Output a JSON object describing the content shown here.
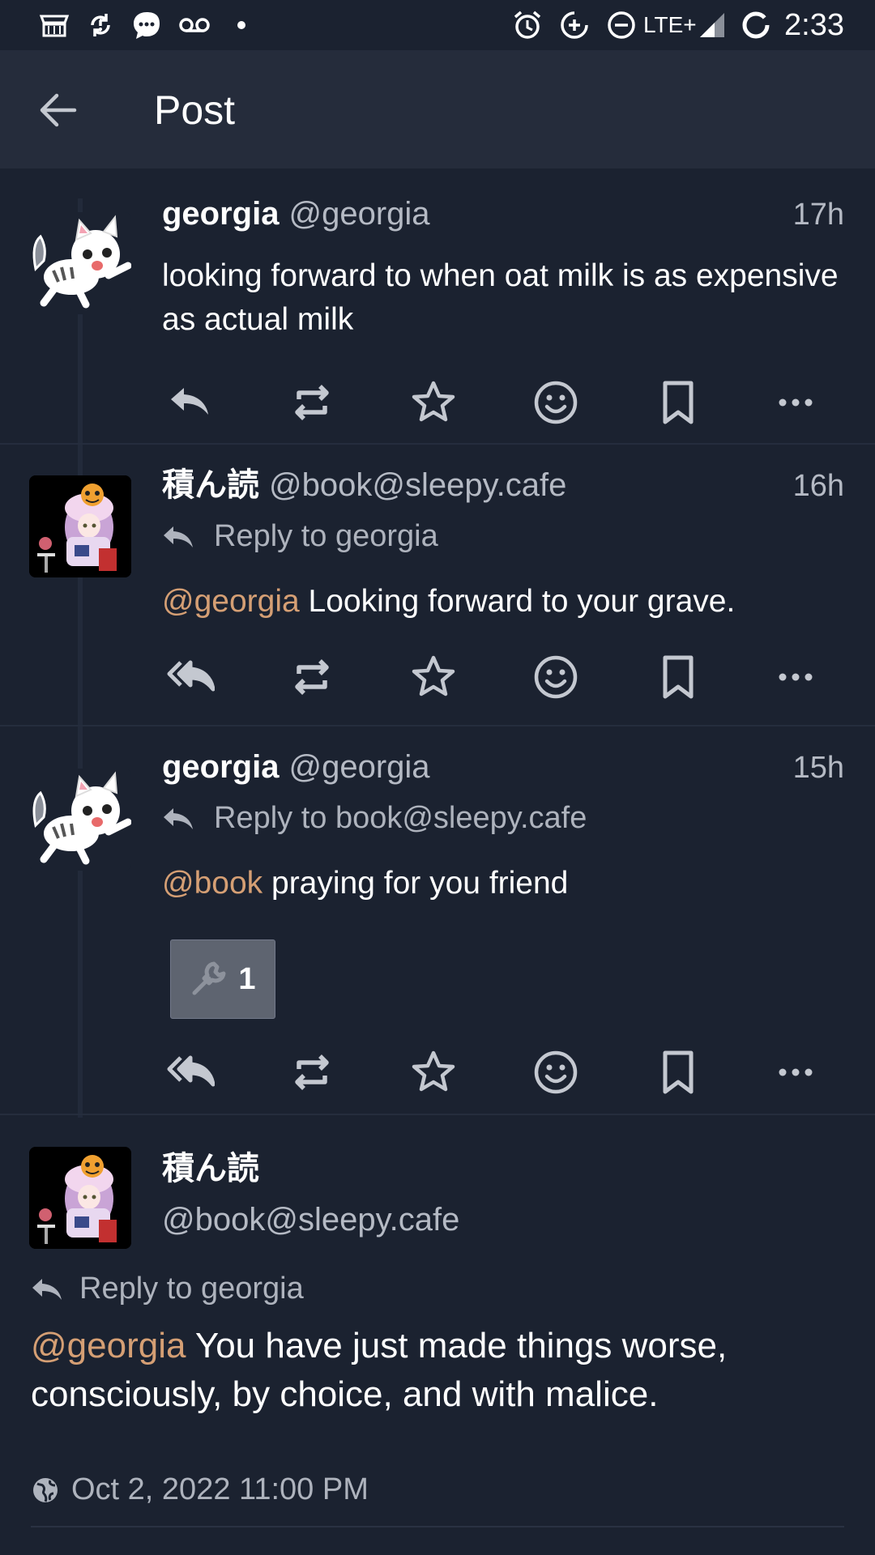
{
  "status_bar": {
    "time": "2:33",
    "network": "LTE+",
    "icons": [
      "store-icon",
      "sync-icon",
      "message-icon",
      "voicemail-icon",
      "dot-icon",
      "alarm-icon",
      "data-saver-icon",
      "do-not-disturb-icon",
      "signal-icon",
      "battery-icon"
    ]
  },
  "app_bar": {
    "title": "Post",
    "back_icon": "arrow-left-icon"
  },
  "posts": [
    {
      "display_name": "georgia",
      "handle": "@georgia",
      "time": "17h",
      "reply_to": "",
      "mention": "",
      "text": "looking forward to when oat milk is as expensive as actual milk",
      "actions": [
        "reply-icon",
        "boost-icon",
        "favourite-icon",
        "emoji-icon",
        "bookmark-icon",
        "more-icon"
      ]
    },
    {
      "display_name": "積ん読",
      "handle": "@book@sleepy.cafe",
      "time": "16h",
      "reply_to": "Reply to georgia",
      "mention": "@georgia",
      "text": " Looking forward to your grave.",
      "actions": [
        "reply-all-icon",
        "boost-icon",
        "favourite-icon",
        "emoji-icon",
        "bookmark-icon",
        "more-icon"
      ]
    },
    {
      "display_name": "georgia",
      "handle": "@georgia",
      "time": "15h",
      "reply_to": "Reply to book@sleepy.cafe",
      "mention": "@book",
      "text": " praying for you friend",
      "reaction": {
        "icon": "wrench-icon",
        "count": "1"
      },
      "actions": [
        "reply-all-icon",
        "boost-icon",
        "favourite-icon",
        "emoji-icon",
        "bookmark-icon",
        "more-icon"
      ]
    }
  ],
  "detail": {
    "display_name": "積ん読",
    "handle": "@book@sleepy.cafe",
    "reply_to": "Reply to georgia",
    "mention": "@georgia",
    "text": " You have just made things worse, consciously, by choice, and with malice.",
    "visibility_icon": "globe-icon",
    "timestamp": "Oct 2, 2022 11:00 PM"
  },
  "colors": {
    "background": "#1b2230",
    "app_bar": "#252c3b",
    "mention": "#d59f74",
    "secondary_text": "#b5bac4",
    "icon": "#c4c8d0"
  }
}
